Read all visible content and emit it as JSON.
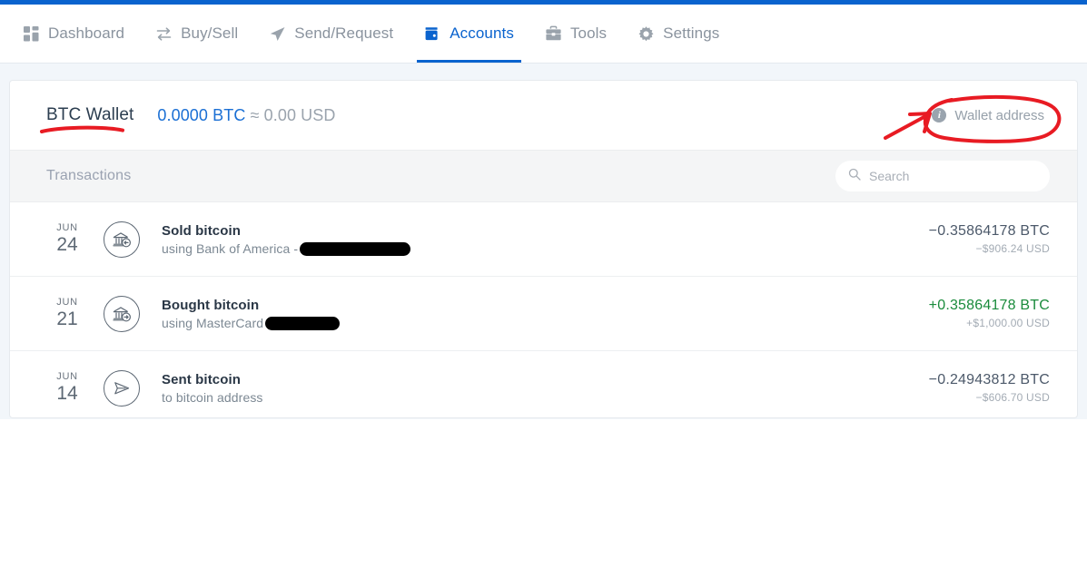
{
  "nav": {
    "items": [
      {
        "label": "Dashboard",
        "icon": "dashboard-icon",
        "active": false
      },
      {
        "label": "Buy/Sell",
        "icon": "exchange-icon",
        "active": false
      },
      {
        "label": "Send/Request",
        "icon": "send-icon",
        "active": false
      },
      {
        "label": "Accounts",
        "icon": "wallet-icon",
        "active": true
      },
      {
        "label": "Tools",
        "icon": "toolbox-icon",
        "active": false
      },
      {
        "label": "Settings",
        "icon": "gear-icon",
        "active": false
      }
    ]
  },
  "wallet": {
    "name": "BTC Wallet",
    "balance_btc": "0.0000 BTC",
    "approx_separator": "≈",
    "balance_usd": "0.00 USD",
    "address_button": "Wallet address",
    "info_glyph": "i"
  },
  "transactions_panel": {
    "title": "Transactions",
    "search": {
      "placeholder": "Search",
      "value": "",
      "icon": "search-icon"
    },
    "rows": [
      {
        "month": "JUN",
        "day": "24",
        "icon": "bank-outgoing-icon",
        "title": "Sold bitcoin",
        "subtitle": "using Bank of America -",
        "redacted": true,
        "redaction_width": 122,
        "amount_btc": "−0.35864178 BTC",
        "amount_usd": "−$906.24 USD",
        "positive": false
      },
      {
        "month": "JUN",
        "day": "21",
        "icon": "bank-incoming-icon",
        "title": "Bought bitcoin",
        "subtitle": "using MasterCard",
        "redacted": true,
        "redaction_width": 82,
        "amount_btc": "+0.35864178 BTC",
        "amount_usd": "+$1,000.00 USD",
        "positive": true
      },
      {
        "month": "JUN",
        "day": "14",
        "icon": "paper-plane-icon",
        "title": "Sent bitcoin",
        "subtitle": "to bitcoin address",
        "redacted": false,
        "redaction_width": 0,
        "amount_btc": "−0.24943812 BTC",
        "amount_usd": "−$606.70 USD",
        "positive": false
      }
    ]
  },
  "annotations": {
    "color": "#e81b23",
    "underline_target": "BTC Wallet",
    "circle_target": "Wallet address",
    "arrow_target": "Wallet address"
  },
  "colors": {
    "brand_blue": "#0a63ce",
    "link_blue": "#1a6fd4",
    "positive_green": "#1a8b3c",
    "page_bg": "#f2f6fa",
    "annotation_red": "#e81b23"
  }
}
